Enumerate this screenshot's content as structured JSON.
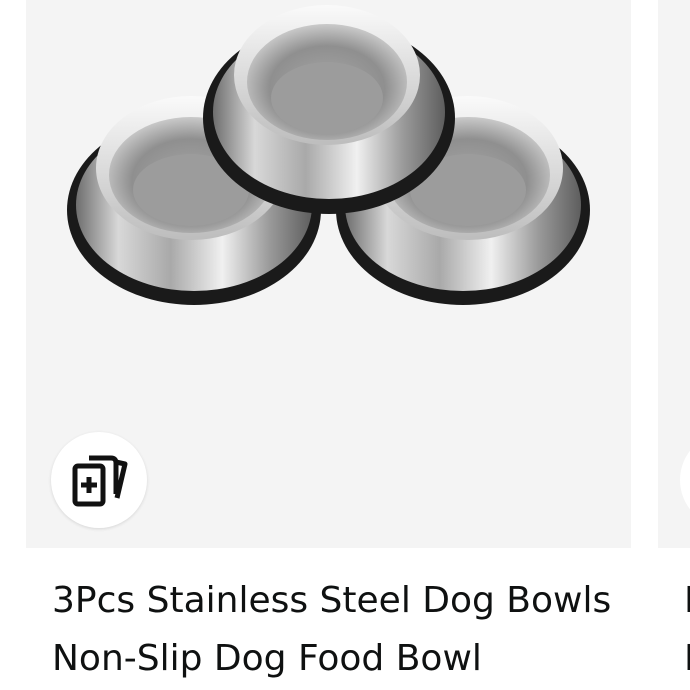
{
  "product_card": {
    "title": "3Pcs Stainless Steel Dog Bowls Non-Slip Dog Food Bowl",
    "compare_icon": "add-to-compare-icon"
  },
  "next_card": {
    "title_peek": "I\nI"
  }
}
